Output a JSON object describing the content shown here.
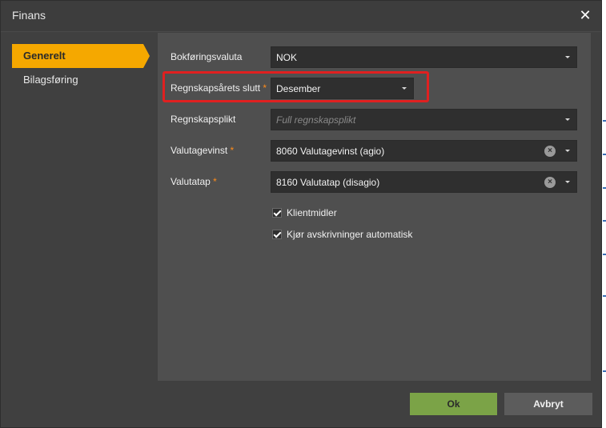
{
  "dialog": {
    "title": "Finans",
    "close_glyph": "✕"
  },
  "nav": {
    "items": [
      {
        "label": "Generelt",
        "active": true
      },
      {
        "label": "Bilagsføring",
        "active": false
      }
    ]
  },
  "form": {
    "bokforingsvaluta": {
      "label": "Bokføringsvaluta",
      "value": "NOK"
    },
    "regnskapsaar_slutt": {
      "label": "Regnskapsårets slutt",
      "required_mark": "*",
      "value": "Desember"
    },
    "regnskapsplikt": {
      "label": "Regnskapsplikt",
      "placeholder": "Full regnskapsplikt"
    },
    "valutagevinst": {
      "label": "Valutagevinst",
      "required_mark": "*",
      "value": "8060 Valutagevinst (agio)"
    },
    "valutatap": {
      "label": "Valutatap",
      "required_mark": "*",
      "value": "8160 Valutatap (disagio)"
    },
    "klientmidler": {
      "label": "Klientmidler",
      "checked": true
    },
    "avskrivninger": {
      "label": "Kjør avskrivninger automatisk",
      "checked": true
    }
  },
  "footer": {
    "ok_label": "Ok",
    "cancel_label": "Avbryt"
  },
  "colors": {
    "accent": "#f5a800",
    "ok_button": "#7ba347",
    "highlight": "#e02020",
    "required": "#ff8c1a"
  }
}
